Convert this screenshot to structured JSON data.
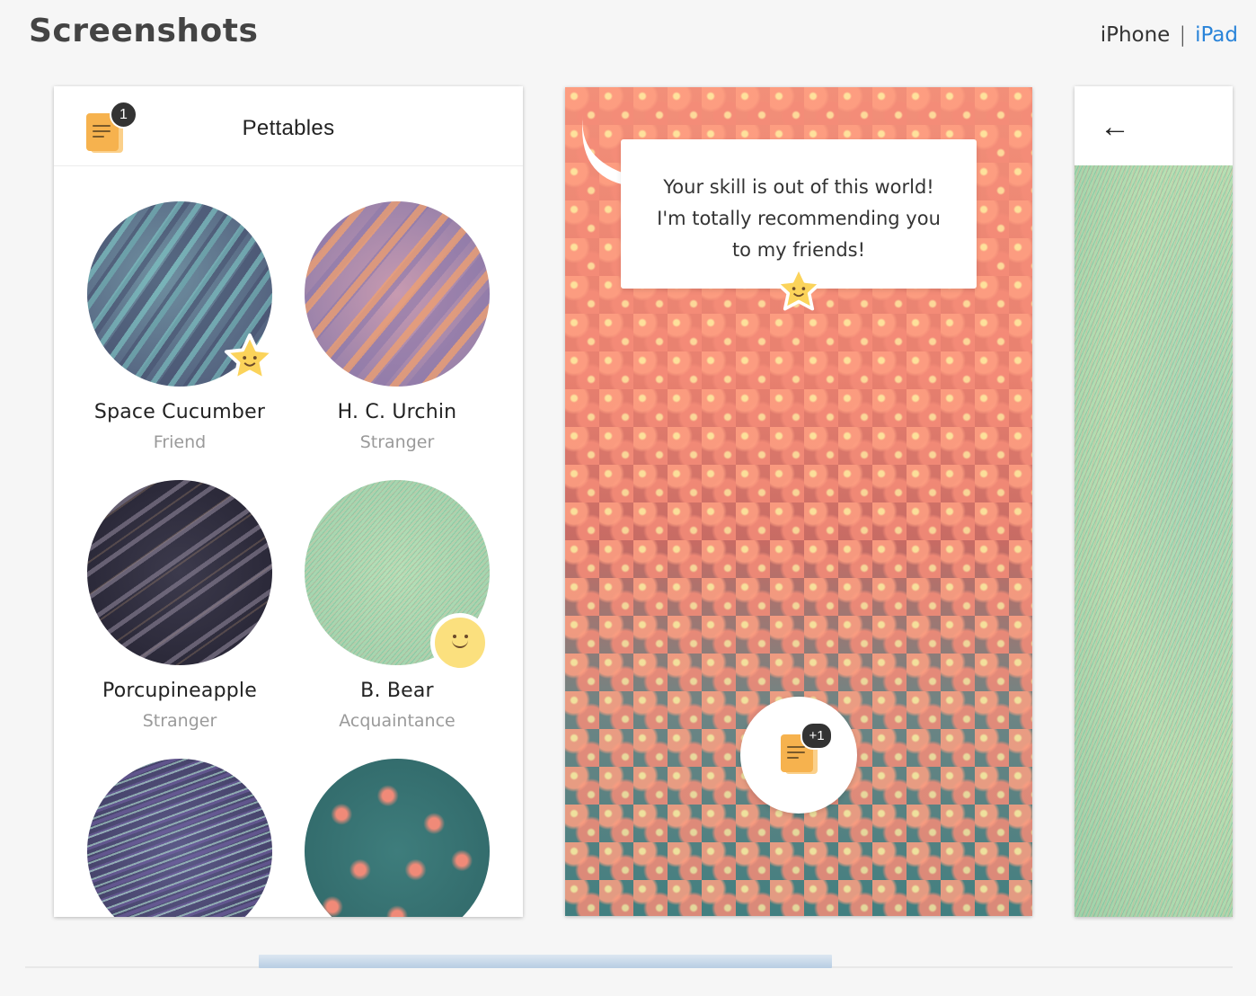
{
  "section": {
    "title": "Screenshots"
  },
  "device_switch": {
    "iphone": "iPhone",
    "separator": "|",
    "ipad": "iPad",
    "active": "iPad"
  },
  "shot1": {
    "app_title": "Pettables",
    "inbox_badge": "1",
    "pets": [
      {
        "name": "Space Cucumber",
        "status": "Friend",
        "face": "star-face-icon"
      },
      {
        "name": "H. C. Urchin",
        "status": "Stranger"
      },
      {
        "name": "Porcupineapple",
        "status": "Stranger"
      },
      {
        "name": "B. Bear",
        "status": "Acquaintance",
        "face": "smiley-face-icon"
      }
    ]
  },
  "shot2": {
    "speech_lines": [
      "Your skill is out of this world!",
      "I'm totally recommending you",
      "to my friends!"
    ],
    "note_badge": "+1"
  },
  "shot3": {
    "back_icon": "back-arrow-icon"
  },
  "colors": {
    "link": "#2a84d9",
    "note": "#f6b24e",
    "star": "#fbd35a"
  },
  "scroll": {
    "visible_fraction": 0.47
  }
}
